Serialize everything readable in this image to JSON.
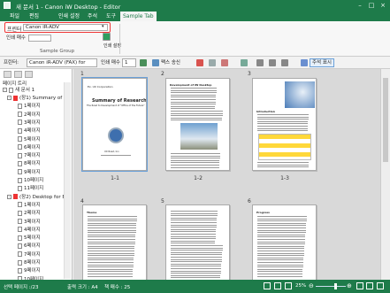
{
  "window": {
    "title": "새 문서 1 - Canon iW Desktop - Editor"
  },
  "ribbon": {
    "tabs": [
      "파일",
      "편집",
      "인쇄 설정",
      "주석",
      "도구",
      "Sample Tab"
    ],
    "printer_label": "프린터",
    "printer_value": "Canon iR-ADV",
    "copies_label": "인쇄 매수",
    "copies_value": "",
    "print_label": "인쇄 설정",
    "group_label": "Sample Group"
  },
  "toolbar": {
    "printer_label": "프린터:",
    "printer_value": "Canon iR-ADV (FAX) for",
    "copies_label": "인쇄 매수",
    "copies_value": "1",
    "fax_label": "팩스 송신",
    "annotation_label": "주석 표시"
  },
  "sidebar": {
    "header": "페이지 트리",
    "root": "새 문서 1",
    "groups": [
      {
        "label": "(장1) Summary of R",
        "pages": [
          "1페이지",
          "2페이지",
          "3페이지",
          "4페이지",
          "5페이지",
          "6페이지",
          "7페이지",
          "8페이지",
          "9페이지",
          "10페이지",
          "11페이지"
        ]
      },
      {
        "label": "(장2) Desktop for Be",
        "pages": [
          "1페이지",
          "2페이지",
          "3페이지",
          "4페이지",
          "5페이지",
          "6페이지",
          "7페이지",
          "8페이지",
          "9페이지",
          "10페이지",
          "11페이지",
          "12페이지"
        ]
      }
    ]
  },
  "main": {
    "column_numbers": [
      "1",
      "2",
      "3",
      "4",
      "5",
      "6"
    ],
    "captions": [
      "1-1",
      "1-2",
      "1-3"
    ],
    "page1": {
      "header": "Ex. UX Corporation",
      "title": "Summary of Research",
      "subtitle": "The Road to Development of \"Office of the Future\"",
      "footer": "UX Road, Inc."
    },
    "page2": {
      "title": "Development of IW Desktop"
    },
    "page3": {
      "title": "Introduction"
    },
    "page4": {
      "title": "Theme"
    },
    "page6": {
      "title": "Progress"
    }
  },
  "status": {
    "selected_page": "선택 페이지 :/23",
    "output_size": "출력 크기 : A4",
    "book_pages": "책 매수 : 25",
    "zoom": "25%"
  },
  "colors": {
    "accent": "#1e7b4a",
    "highlight": "#e33333",
    "selection": "#6aa0d8"
  }
}
